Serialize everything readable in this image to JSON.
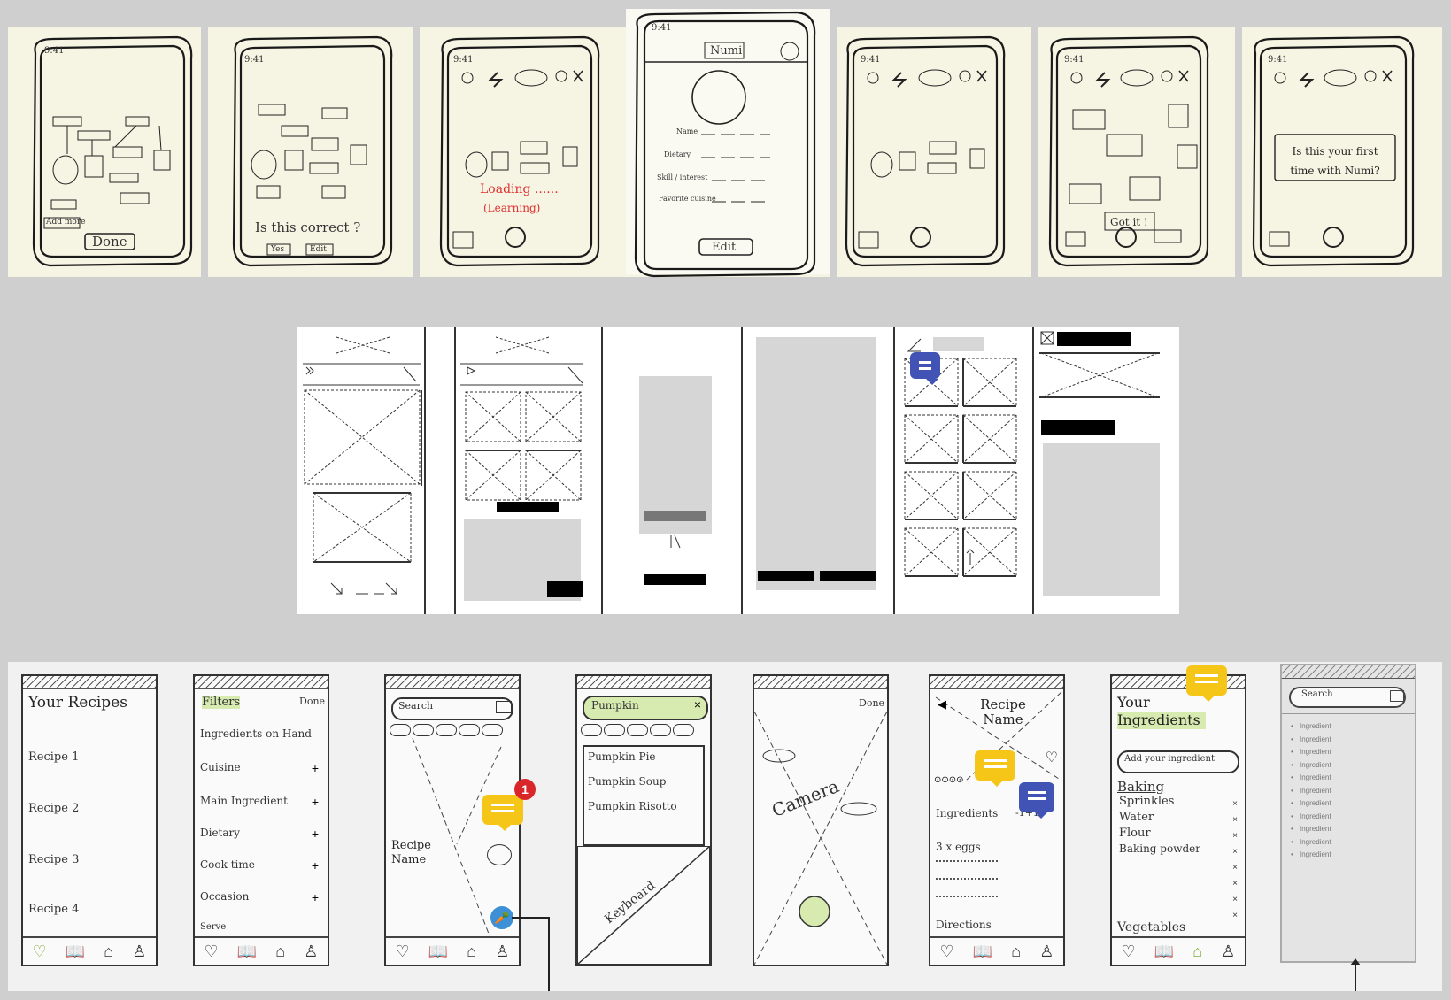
{
  "sketches_top": {
    "status_time": "9:41",
    "done_label": "Done",
    "correct_prompt": "Is this correct ?",
    "correct_yes": "Yes",
    "correct_edit": "Edit",
    "loading": "Loading ......",
    "loading_sub": "(Learning)",
    "app_name": "Numi",
    "profile_fields": [
      "Name",
      "Dietary",
      "Skill / interest",
      "Favorite cuisine"
    ],
    "edit_label": "Edit",
    "got_it": "Got it !",
    "first_time": "Is this your first time with Numi?",
    "labels": [
      "Done",
      "Add more"
    ]
  },
  "lofi_bottom": {
    "screen1": {
      "title": "Your Recipes",
      "rows": [
        "Recipe 1",
        "Recipe 2",
        "Recipe 3",
        "Recipe 4"
      ]
    },
    "screen2": {
      "filter": "Filters",
      "done": "Done",
      "rows": [
        "Ingredients on Hand",
        "Cuisine",
        "Main Ingredient",
        "Dietary",
        "Cook time",
        "Occasion",
        "Serve"
      ]
    },
    "screen3": {
      "search": "Search",
      "recipe_name": "Recipe Name",
      "badge_count": "1"
    },
    "screen4": {
      "search_value": "Pumpkin",
      "rows": [
        "Pumpkin Pie",
        "Pumpkin Soup",
        "Pumpkin Risotto"
      ],
      "keyboard": "Keyboard"
    },
    "screen5": {
      "done": "Done",
      "camera": "Camera"
    },
    "screen6": {
      "recipe_name": "Recipe Name",
      "ingredients": "Ingredients",
      "serve": "-1+1",
      "rows": [
        "3 x eggs"
      ],
      "directions": "Directions"
    },
    "screen7": {
      "title": "Your Ingredients",
      "add": "Add your ingredient",
      "section": "Baking",
      "items": [
        "Sprinkles",
        "Water",
        "Flour",
        "Baking powder"
      ],
      "section2": "Vegetables"
    },
    "screen8": {
      "search": "Search",
      "items": [
        "Ingredient",
        "Ingredient",
        "Ingredient",
        "Ingredient",
        "Ingredient",
        "Ingredient",
        "Ingredient",
        "Ingredient",
        "Ingredient",
        "Ingredient",
        "Ingredient"
      ]
    }
  },
  "colors": {
    "bg": "#cfcfcf",
    "paper": "#f6f4e3",
    "comment_yellow": "#f5c518",
    "comment_blue": "#4154b5",
    "badge_red": "#d9262b",
    "loading_red": "#e03030",
    "highlight_green": "#d7ebb0"
  }
}
